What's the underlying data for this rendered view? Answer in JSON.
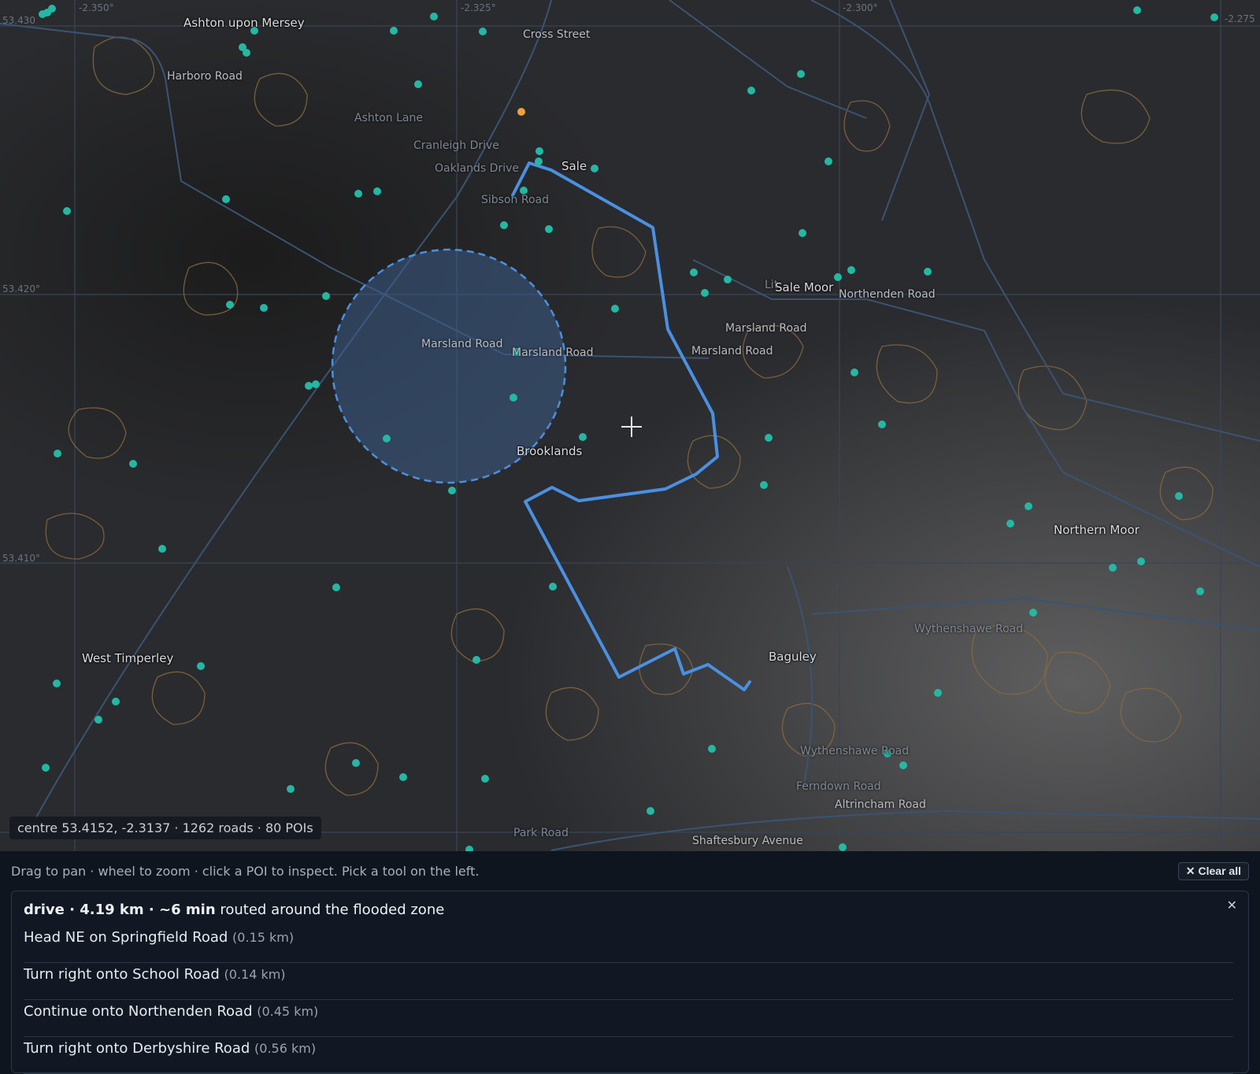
{
  "map": {
    "grid_labels": {
      "lon": [
        "-2.350°",
        "-2.325°",
        "-2.300°",
        "-2.275"
      ],
      "lat": [
        "53.430",
        "53.420°",
        "53.410°"
      ]
    },
    "places": {
      "ashton_upon_mersey": "Ashton upon Mersey",
      "cross_street": "Cross Street",
      "harboro_road": "Harboro Road",
      "ashton_lane": "Ashton Lane",
      "cranleigh_drive": "Cranleigh Drive",
      "oaklands_drive": "Oaklands Drive",
      "sale": "Sale",
      "sibson_road": "Sibson Road",
      "sale_moor": "Sale Moor",
      "northenden_road": "Northenden Road",
      "marsland_road_1": "Marsland Road",
      "marsland_road_2": "Marsland Road",
      "marsland_road_3": "Marsland Road",
      "marsland_road_4": "Marsland Road",
      "brooklands": "Brooklands",
      "northern_moor": "Northern Moor",
      "wythenshawe_road_1": "Wythenshawe Road",
      "west_timperley": "West Timperley",
      "baguley": "Baguley",
      "wythenshawe_road_2": "Wythenshawe Road",
      "ferndown_road": "Ferndown Road",
      "altrincham_road": "Altrincham Road",
      "park_road": "Park Road",
      "shaftesbury_avenue": "Shaftesbury Avenue",
      "little_road": "Lit..."
    },
    "colors": {
      "route": "#4a90e2",
      "poi": "#23b8a4",
      "selected_poi": "#f0a040",
      "flood_zone": "#3d5d88",
      "contour": "#8a6a3c"
    },
    "poi_count_visible": 80,
    "status": "centre 53.4152, -2.3137 · 1262 roads · 80 POIs"
  },
  "panel": {
    "hint": "Drag to pan · wheel to zoom · click a POI to inspect. Pick a tool on the left.",
    "clear_all": "✕ Clear all",
    "route": {
      "summary_bold": "drive · 4.19 km · ~6 min",
      "summary_rest": " routed around the flooded zone",
      "close": "✕",
      "steps": [
        {
          "text": "Head NE on Springfield Road",
          "dist": "(0.15 km)"
        },
        {
          "text": "Turn right onto School Road",
          "dist": "(0.14 km)"
        },
        {
          "text": "Continue onto Northenden Road",
          "dist": "(0.45 km)"
        },
        {
          "text": "Turn right onto Derbyshire Road",
          "dist": "(0.56 km)"
        }
      ]
    }
  }
}
